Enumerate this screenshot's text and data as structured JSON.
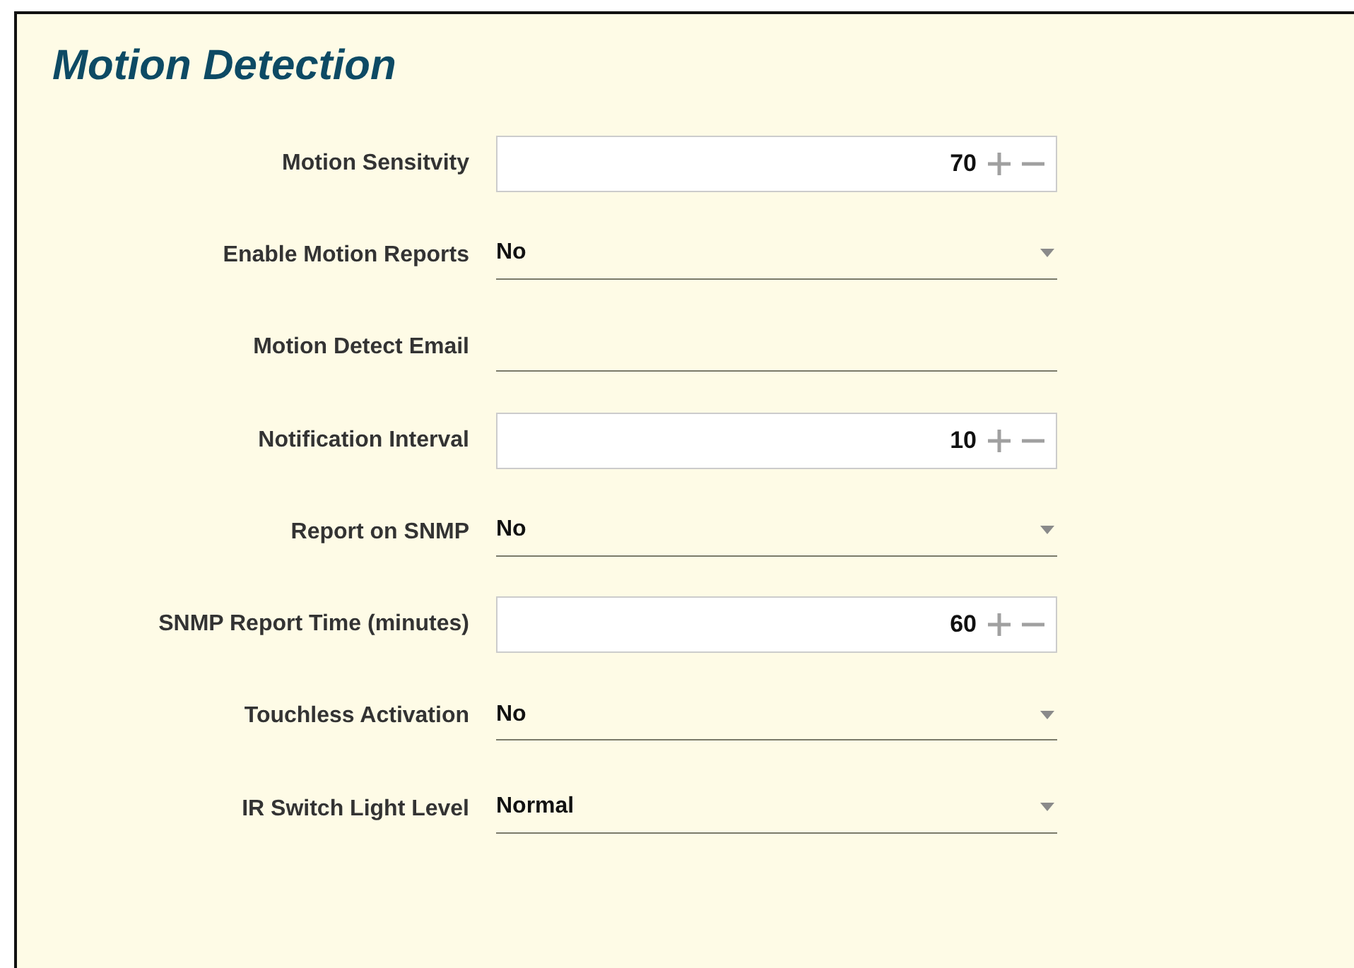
{
  "title": "Motion Detection",
  "fields": [
    {
      "label": "Motion Sensitvity",
      "kind": "number",
      "value": "70"
    },
    {
      "label": "Enable Motion Reports",
      "kind": "select",
      "value": "No"
    },
    {
      "label": "Motion Detect Email",
      "kind": "text"
    },
    {
      "label": "Notification Interval",
      "kind": "number",
      "value": "10"
    },
    {
      "label": "Report on SNMP",
      "kind": "select",
      "value": "No"
    },
    {
      "label": "SNMP Report Time (minutes)",
      "kind": "number",
      "value": "60"
    },
    {
      "label": "Touchless Activation",
      "kind": "select",
      "value": "No"
    },
    {
      "label": "IR Switch Light Level",
      "kind": "select",
      "value": "Normal"
    }
  ]
}
